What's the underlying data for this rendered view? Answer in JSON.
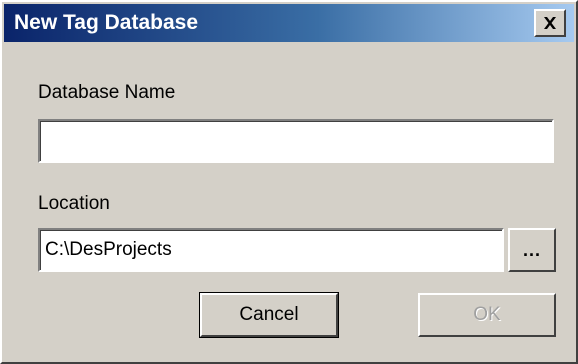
{
  "window": {
    "title": "New Tag Database",
    "close_label": "close"
  },
  "form": {
    "database_name_label": "Database Name",
    "database_name_value": "",
    "location_label": "Location",
    "location_value": "C:\\DesProjects",
    "browse_label": "..."
  },
  "buttons": {
    "cancel_label": "Cancel",
    "ok_label": "OK",
    "ok_enabled": false
  },
  "colors": {
    "titlebar_start": "#0a246a",
    "titlebar_end": "#a6caf0",
    "dialog_face": "#d4d0c8",
    "disabled_text": "#a0a0a0"
  },
  "icons": {
    "close": "close-icon"
  }
}
